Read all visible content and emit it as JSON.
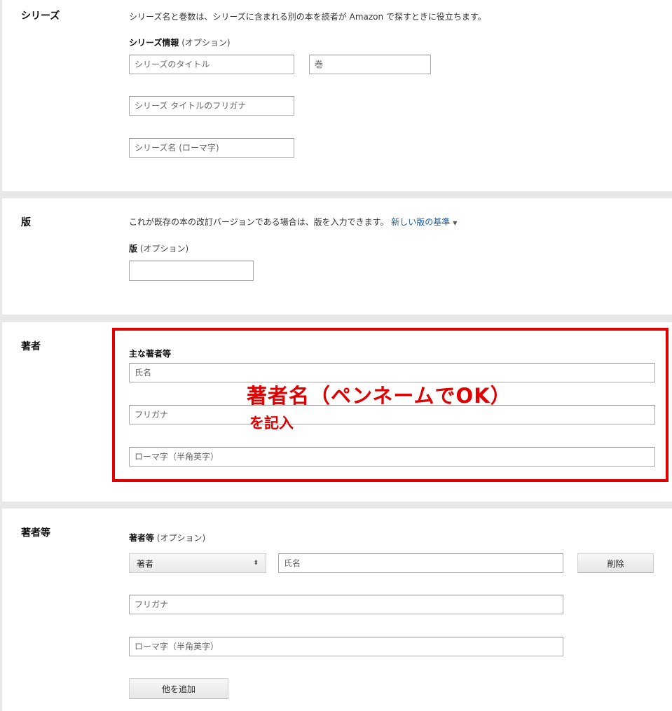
{
  "series": {
    "title": "シリーズ",
    "description": "シリーズ名と巻数は、シリーズに含まれる別の本を読者が Amazon で探すときに役立ちます。",
    "label": "シリーズ情報",
    "optional": "(オプション)",
    "title_placeholder": "シリーズのタイトル",
    "volume_placeholder": "巻",
    "furigana_placeholder": "シリーズ タイトルのフリガナ",
    "romaji_placeholder": "シリーズ名 (ローマ字)"
  },
  "edition": {
    "title": "版",
    "description": "これが既存の本の改訂バージョンである場合は、版を入力できます。",
    "link": "新しい版の基準",
    "label": "版",
    "optional": "(オプション)",
    "value": ""
  },
  "author": {
    "title": "著者",
    "label": "主な著者等",
    "name_placeholder": "氏名",
    "furigana_placeholder": "フリガナ",
    "romaji_placeholder": "ローマ字（半角英字）"
  },
  "contributors": {
    "title": "著者等",
    "label": "著者等",
    "optional": "(オプション)",
    "role_selected": "著者",
    "name_placeholder": "氏名",
    "delete_label": "削除",
    "furigana_placeholder": "フリガナ",
    "romaji_placeholder": "ローマ字（半角英字）",
    "add_label": "他を追加"
  },
  "annotation": {
    "main": "著者名（ペンネームでOK）",
    "sub": "を記入",
    "color": "#e00000"
  },
  "colors": {
    "link": "#1a5aa8",
    "page_bg": "#e8e8e8"
  }
}
